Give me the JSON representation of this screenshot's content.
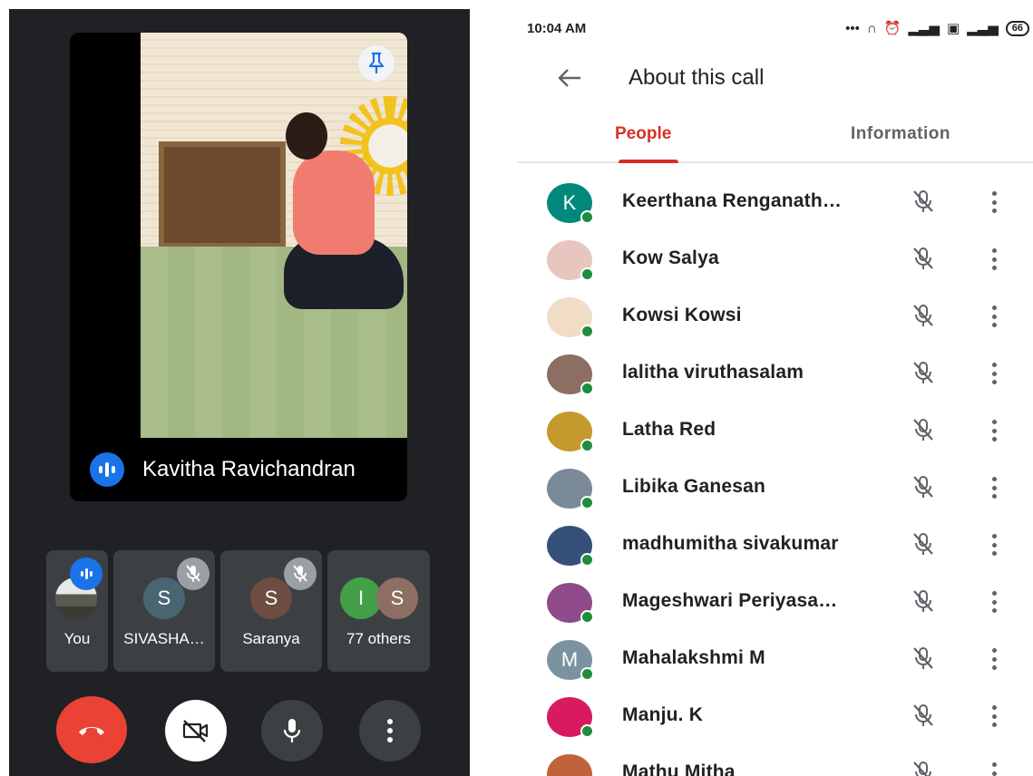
{
  "meet": {
    "main_speaker": {
      "name": "Kavitha Ravichandran",
      "pin_icon": "pin-icon",
      "speaking_icon": "audio-level-icon"
    },
    "thumbnails": [
      {
        "label": "You",
        "badge": "speaking"
      },
      {
        "label": "SIVASHA…",
        "avatar_letter": "S",
        "avatar_color": "#4a6572",
        "muted": true
      },
      {
        "label": "Saranya",
        "avatar_letter": "S",
        "avatar_color": "#6d4c41",
        "muted": true
      },
      {
        "label": "77 others",
        "avatar_letters": [
          "I",
          "S"
        ],
        "avatar_colors": [
          "#43a047",
          "#8d6e63"
        ]
      }
    ],
    "controls": [
      {
        "name": "end-call",
        "icon": "phone-hangup-icon",
        "color": "#ea4335"
      },
      {
        "name": "camera-off",
        "icon": "video-off-icon"
      },
      {
        "name": "microphone",
        "icon": "mic-icon"
      },
      {
        "name": "more-options",
        "icon": "more-vert-icon"
      }
    ]
  },
  "about": {
    "status": {
      "time": "10:04 AM",
      "battery": "66"
    },
    "title": "About this call",
    "tabs": [
      {
        "label": "People",
        "active": true
      },
      {
        "label": "Information",
        "active": false
      }
    ],
    "accent_color": "#d93025",
    "people": [
      {
        "name": "Keerthana Renganath…",
        "avatar": "K",
        "avatar_color": "#00897b"
      },
      {
        "name": "Kow Salya",
        "avatar": "",
        "avatar_color": "#e8c6c0"
      },
      {
        "name": "Kowsi Kowsi",
        "avatar": "",
        "avatar_color": "#f1dcc6"
      },
      {
        "name": "lalitha viruthasalam",
        "avatar": "",
        "avatar_color": "#8d6e63"
      },
      {
        "name": "Latha Red",
        "avatar": "",
        "avatar_color": "#c49a2c"
      },
      {
        "name": "Libika Ganesan",
        "avatar": "",
        "avatar_color": "#7a8a99"
      },
      {
        "name": "madhumitha sivakumar",
        "avatar": "",
        "avatar_color": "#35507a"
      },
      {
        "name": "Mageshwari Periyasa…",
        "avatar": "",
        "avatar_color": "#8e4a8a"
      },
      {
        "name": "Mahalakshmi M",
        "avatar": "M",
        "avatar_color": "#7b939e"
      },
      {
        "name": "Manju. K",
        "avatar": "",
        "avatar_color": "#d81b60"
      },
      {
        "name": "Mathu Mitha",
        "avatar": "",
        "avatar_color": "#c0623a"
      }
    ]
  }
}
